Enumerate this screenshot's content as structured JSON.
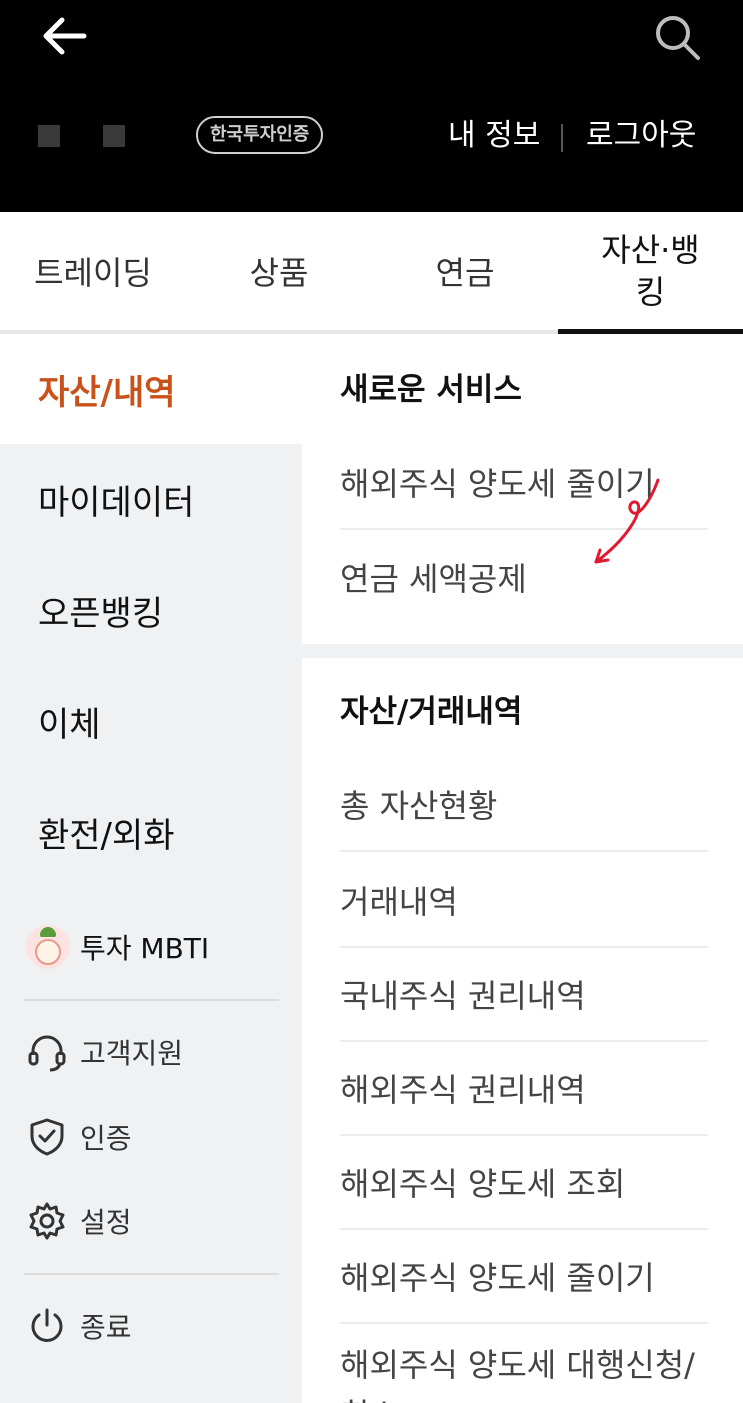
{
  "header": {
    "back_icon": "back-arrow-icon",
    "search_icon": "search-icon",
    "cert_badge": "한국투자인증",
    "my_info": "내 정보",
    "logout": "로그아웃"
  },
  "tabs": [
    {
      "label": "트레이딩"
    },
    {
      "label": "상품"
    },
    {
      "label": "연금"
    },
    {
      "label": "자산·뱅\n킹",
      "active": true
    }
  ],
  "sidebar": {
    "items": [
      {
        "label": "자산/내역",
        "active": true
      },
      {
        "label": "마이데이터"
      },
      {
        "label": "오픈뱅킹"
      },
      {
        "label": "이체"
      },
      {
        "label": "환전/외화"
      }
    ],
    "mbti": {
      "label": "투자 MBTI",
      "icon": "mbti-character-icon"
    },
    "utilities": [
      {
        "label": "고객지원",
        "icon": "headset-icon"
      },
      {
        "label": "인증",
        "icon": "shield-check-icon"
      },
      {
        "label": "설정",
        "icon": "gear-icon"
      },
      {
        "label": "종료",
        "icon": "power-icon"
      }
    ]
  },
  "new_services": {
    "title": "새로운 서비스",
    "items": [
      "해외주식 양도세 줄이기",
      "연금 세액공제"
    ]
  },
  "asset_history": {
    "title": "자산/거래내역",
    "items": [
      "총 자산현황",
      "거래내역",
      "국내주식 권리내역",
      "해외주식 권리내역",
      "해외주식 양도세 조회",
      "해외주식 양도세 줄이기",
      "해외주식 양도세 대행신청/취소"
    ]
  },
  "colors": {
    "active_accent": "#c8521a",
    "annotation": "#e01b2f",
    "header_bg": "#000000"
  }
}
